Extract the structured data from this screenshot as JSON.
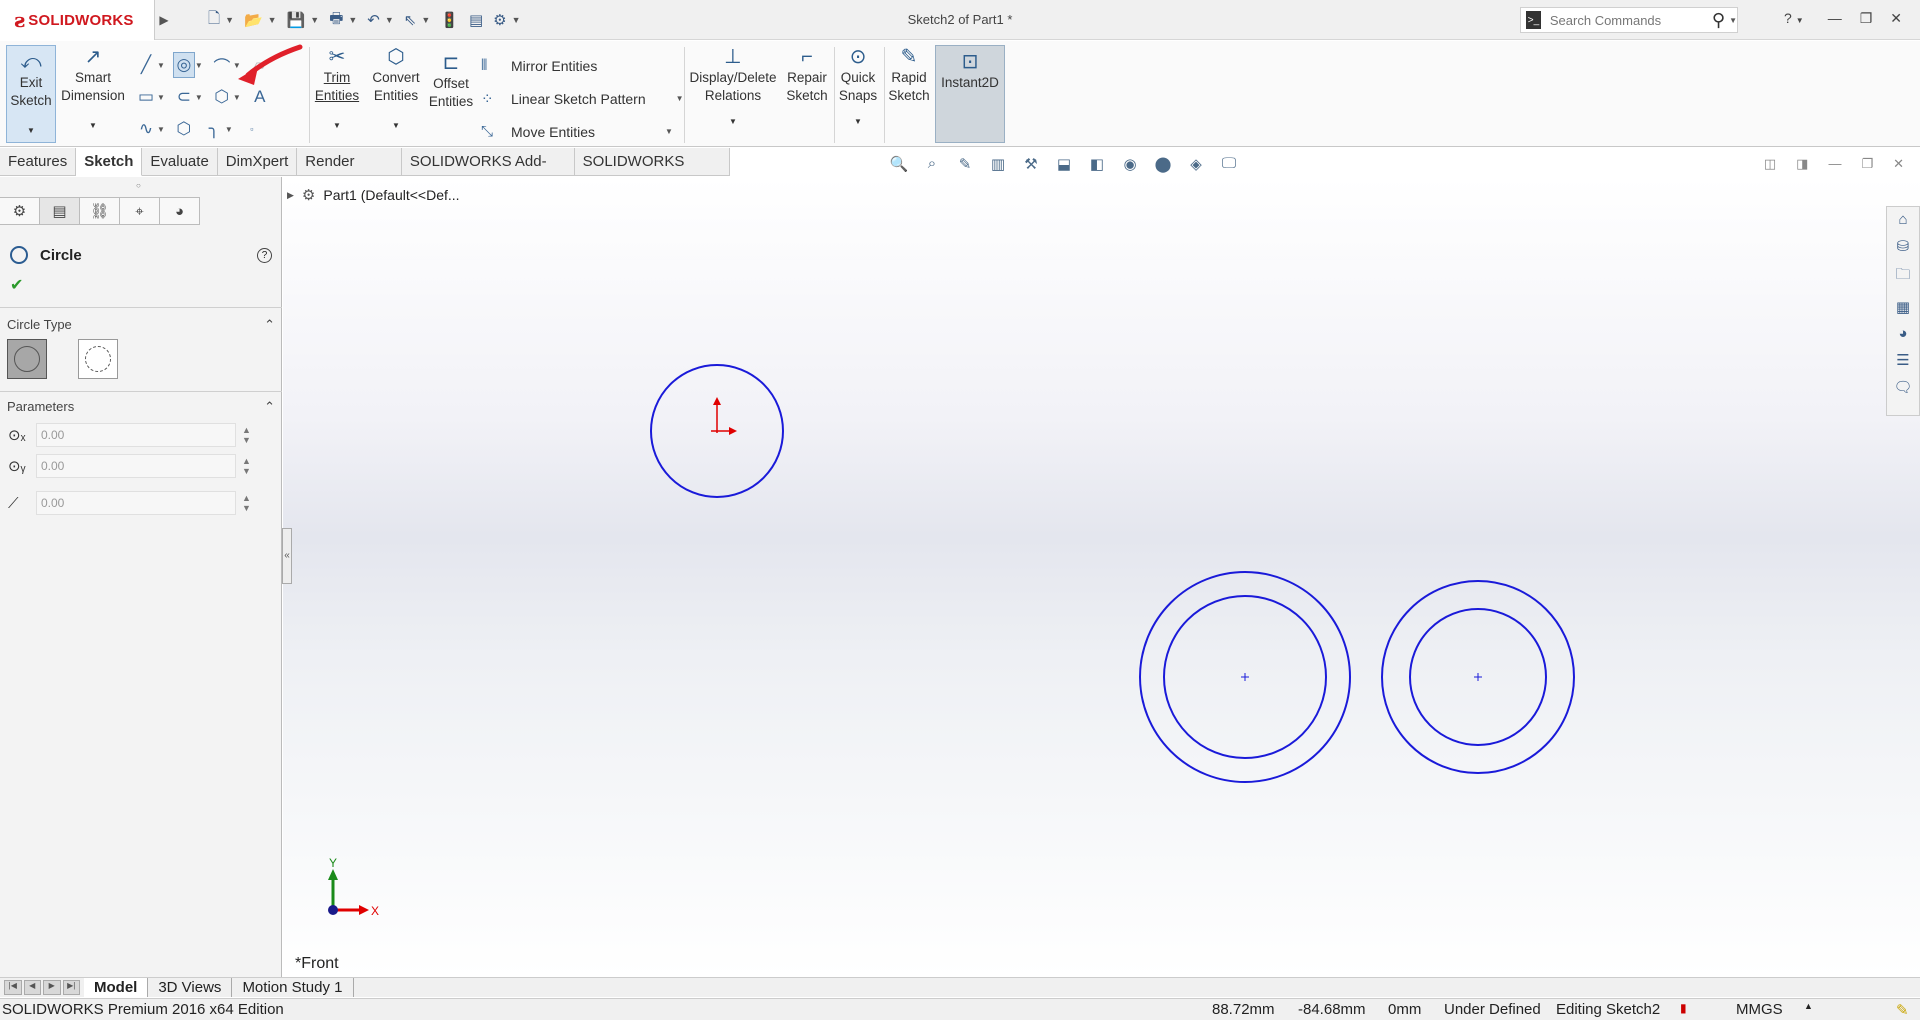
{
  "app": {
    "brand": "SOLIDWORKS",
    "document_title": "Sketch2 of Part1 *",
    "search_placeholder": "Search Commands",
    "help_label": "?"
  },
  "ribbon": {
    "exit_sketch": "Exit\nSketch",
    "smart_dimension": "Smart\nDimension",
    "trim_entities": "Trim\nEntities",
    "convert_entities": "Convert\nEntities",
    "offset_entities": "Offset\nEntities",
    "mirror_entities": "Mirror Entities",
    "linear_sketch_pattern": "Linear Sketch Pattern",
    "move_entities": "Move Entities",
    "display_delete_relations": "Display/Delete\nRelations",
    "repair_sketch": "Repair\nSketch",
    "quick_snaps": "Quick\nSnaps",
    "rapid_sketch": "Rapid\nSketch",
    "instant2d": "Instant2D"
  },
  "command_tabs": [
    "Features",
    "Sketch",
    "Evaluate",
    "DimXpert",
    "Render Tools",
    "SOLIDWORKS Add-Ins",
    "SOLIDWORKS MBD"
  ],
  "active_command_tab": "Sketch",
  "feature_tree": {
    "root": "Part1  (Default<<Def..."
  },
  "property_manager": {
    "title": "Circle",
    "help": "?",
    "circle_type_label": "Circle Type",
    "parameters_label": "Parameters",
    "params": [
      {
        "icon": "center-x-icon",
        "value": "0.00"
      },
      {
        "icon": "center-y-icon",
        "value": "0.00"
      },
      {
        "icon": "radius-icon",
        "value": "0.00"
      }
    ]
  },
  "graphics": {
    "view_label": "*Front",
    "axis_x": "X",
    "axis_y": "Y",
    "sketch_color": "#1a1ad9",
    "origin_color": "#e00000"
  },
  "bottom_tabs": [
    "Model",
    "3D Views",
    "Motion Study 1"
  ],
  "active_bottom_tab": "Model",
  "status": {
    "edition": "SOLIDWORKS Premium 2016 x64 Edition",
    "x": "88.72mm",
    "y": "-84.68mm",
    "z": "0mm",
    "state": "Under Defined",
    "editing": "Editing Sketch2",
    "units": "MMGS"
  },
  "colors": {
    "brand_red": "#d0181f",
    "accent_blue": "#2c5c8c",
    "annotation_arrow": "#e0202a"
  }
}
